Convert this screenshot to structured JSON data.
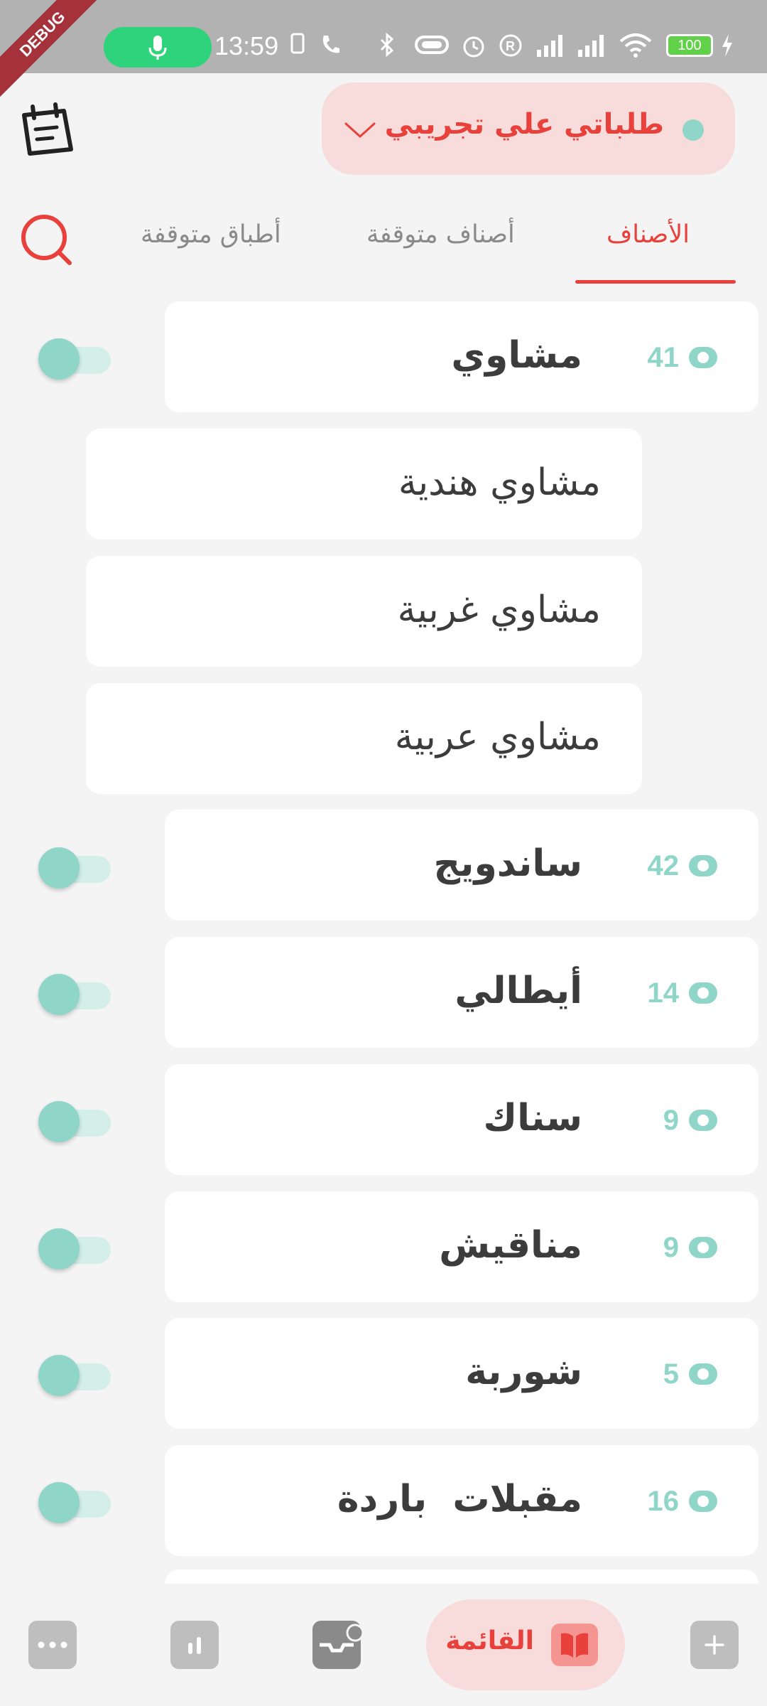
{
  "status_bar": {
    "time": "13:59",
    "battery": "100",
    "debug_label": "DEBUG"
  },
  "header": {
    "restaurant_name": "طلباتي علي تجريبي"
  },
  "tabs": [
    {
      "label": "الأصناف",
      "active": true
    },
    {
      "label": "أصناف متوقفة",
      "active": false
    },
    {
      "label": "أطباق متوقفة",
      "active": false
    }
  ],
  "categories": [
    {
      "name": "مشاوي",
      "count": "41",
      "enabled": true
    },
    {
      "name": "ساندويج",
      "count": "42",
      "enabled": true
    },
    {
      "name": "أيطالي",
      "count": "14",
      "enabled": true
    },
    {
      "name": "سناك",
      "count": "9",
      "enabled": true
    },
    {
      "name": "مناقيش",
      "count": "9",
      "enabled": true
    },
    {
      "name": "شوربة",
      "count": "5",
      "enabled": true
    },
    {
      "name": "مقبلات  باردة",
      "count": "16",
      "enabled": true
    }
  ],
  "subcategories": [
    {
      "name": "مشاوي هندية"
    },
    {
      "name": "مشاوي غربية"
    },
    {
      "name": "مشاوي عربية"
    }
  ],
  "bottom_nav": {
    "menu_label": "القائمة"
  },
  "colors": {
    "accent": "#e8413c",
    "teal": "#8fd6c9",
    "selector_bg": "#f8dcdc"
  }
}
